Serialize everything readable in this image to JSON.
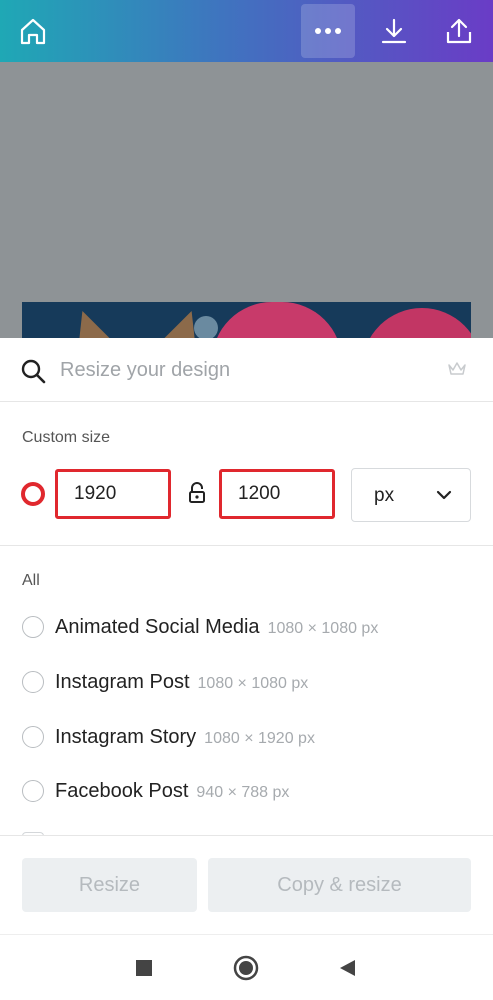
{
  "topbar": {
    "home_icon": "home-icon",
    "more_icon": "more-horizontal-icon",
    "download_icon": "download-icon",
    "share_icon": "share-icon"
  },
  "sheet": {
    "search": {
      "placeholder": "Resize your design",
      "value": ""
    },
    "custom_size_label": "Custom size",
    "custom": {
      "width": "1920",
      "height": "1200",
      "unit": "px"
    },
    "all_label": "All",
    "presets": [
      {
        "name": "Animated Social Media",
        "size": "1080 × 1080 px"
      },
      {
        "name": "Instagram Post",
        "size": "1080 × 1080 px"
      },
      {
        "name": "Instagram Story",
        "size": "1080 × 1920 px"
      },
      {
        "name": "Facebook Post",
        "size": "940 × 788 px"
      }
    ]
  },
  "footer": {
    "resize_label": "Resize",
    "copy_resize_label": "Copy & resize"
  },
  "colors": {
    "accent_red": "#e0282e",
    "topbar_start": "#1fa8b5",
    "topbar_end": "#6a3cc6"
  }
}
